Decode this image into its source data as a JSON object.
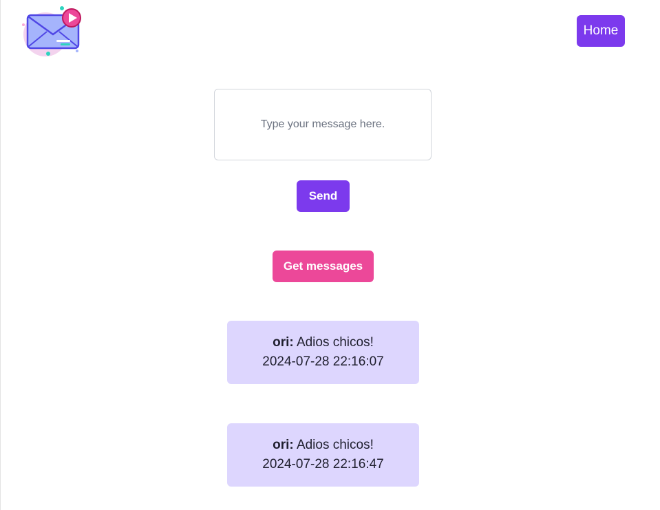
{
  "header": {
    "logo_icon": "envelope-play-icon",
    "home_label": "Home"
  },
  "composer": {
    "placeholder": "Type your message here.",
    "value": "",
    "send_label": "Send"
  },
  "fetch": {
    "get_label": "Get messages"
  },
  "messages": [
    {
      "author": "ori:",
      "text": "Adios chicos!",
      "timestamp": "2024-07-28 22:16:07"
    },
    {
      "author": "ori:",
      "text": "Adios chicos!",
      "timestamp": "2024-07-28 22:16:47"
    }
  ],
  "colors": {
    "primary": "#7c3aed",
    "accent": "#ec4899",
    "card": "#ddd6fe"
  }
}
